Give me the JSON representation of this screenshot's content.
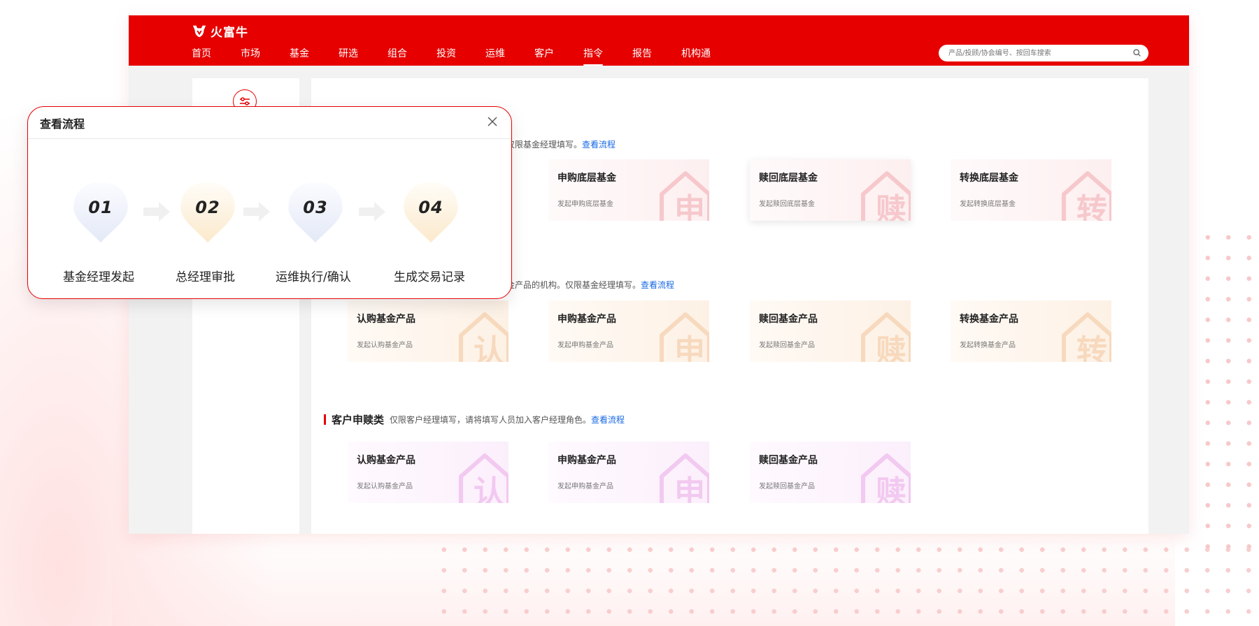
{
  "app": {
    "brand": "火富牛",
    "nav": [
      "首页",
      "市场",
      "基金",
      "研选",
      "组合",
      "投资",
      "运维",
      "客户",
      "指令",
      "报告",
      "机构通"
    ],
    "active_nav": "指令",
    "search_placeholder": "产品/投顾/协会编号、按回车搜索"
  },
  "sections": [
    {
      "desc": "仅限基金经理填写。",
      "link": "查看流程",
      "cards": [
        {
          "title": "申购底层基金",
          "sub": "发起申购底层基金",
          "watermark": "申",
          "tone": "pink"
        },
        {
          "title": "赎回底层基金",
          "sub": "发起赎回底层基金",
          "watermark": "赎",
          "tone": "pink"
        },
        {
          "title": "转换底层基金",
          "sub": "发起转换底层基金",
          "watermark": "转",
          "tone": "pink"
        }
      ]
    },
    {
      "desc": "金产品的机构。仅限基金经理填写。",
      "link": "查看流程",
      "cards": [
        {
          "title": "认购基金产品",
          "sub": "发起认购基金产品",
          "watermark": "认",
          "tone": "peach"
        },
        {
          "title": "申购基金产品",
          "sub": "发起申购基金产品",
          "watermark": "申",
          "tone": "peach"
        },
        {
          "title": "赎回基金产品",
          "sub": "发起赎回基金产品",
          "watermark": "赎",
          "tone": "peach"
        },
        {
          "title": "转换基金产品",
          "sub": "发起转换基金产品",
          "watermark": "转",
          "tone": "peach"
        }
      ]
    },
    {
      "title": "客户申赎类",
      "desc": "仅限客户经理填写，请将填写人员加入客户经理角色。",
      "link": "查看流程",
      "cards": [
        {
          "title": "认购基金产品",
          "sub": "发起认购基金产品",
          "watermark": "认",
          "tone": "lav"
        },
        {
          "title": "申购基金产品",
          "sub": "发起申购基金产品",
          "watermark": "申",
          "tone": "lav"
        },
        {
          "title": "赎回基金产品",
          "sub": "发起赎回基金产品",
          "watermark": "赎",
          "tone": "lav"
        }
      ]
    }
  ],
  "modal": {
    "title": "查看流程",
    "steps": [
      {
        "num": "01",
        "label": "基金经理发起",
        "tone": "blue"
      },
      {
        "num": "02",
        "label": "总经理审批",
        "tone": "gold"
      },
      {
        "num": "03",
        "label": "运维执行/确认",
        "tone": "blue"
      },
      {
        "num": "04",
        "label": "生成交易记录",
        "tone": "gold"
      }
    ]
  },
  "colors": {
    "brand": "#e60000",
    "link": "#1768e5"
  }
}
